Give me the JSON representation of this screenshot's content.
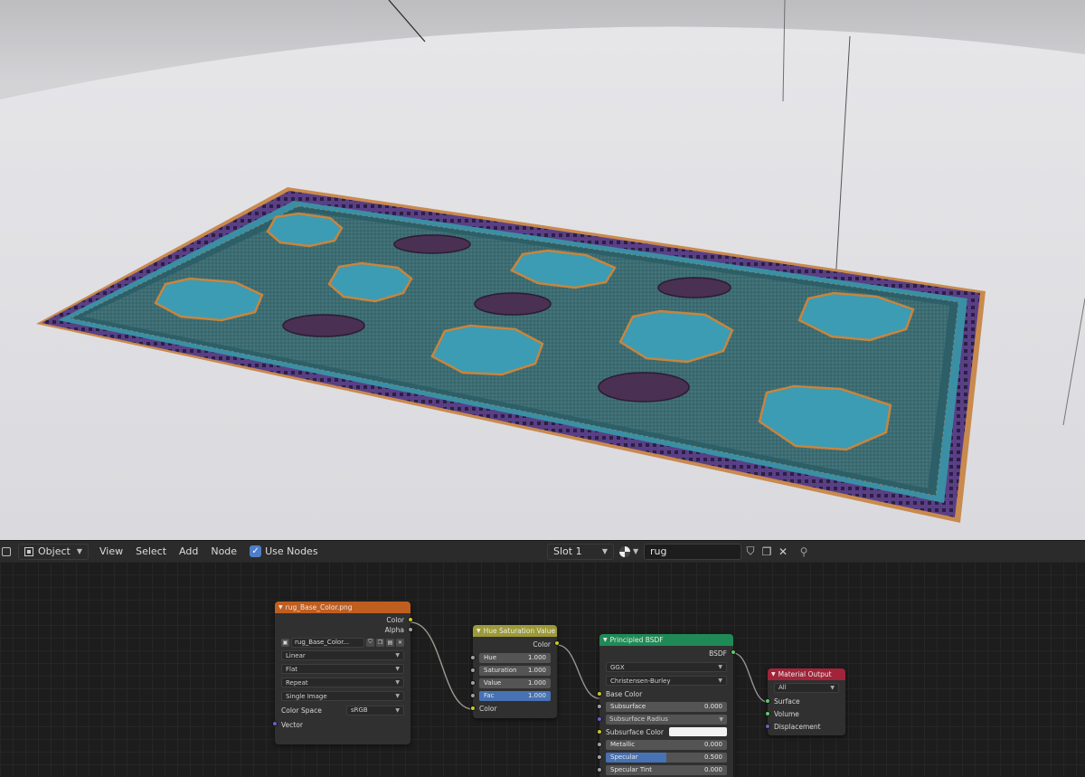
{
  "header": {
    "editor_type_icon": "node-editor-icon",
    "object_mode_label": "Object",
    "menu": [
      "View",
      "Select",
      "Add",
      "Node"
    ],
    "use_nodes_label": "Use Nodes",
    "use_nodes_checked": true,
    "slot_label": "Slot 1",
    "material_name": "rug"
  },
  "nodes": {
    "image_texture": {
      "title": "rug_Base_Color.png",
      "outputs": [
        "Color",
        "Alpha"
      ],
      "image_name": "rug_Base_Color...",
      "interpolation": "Linear",
      "projection": "Flat",
      "extension": "Repeat",
      "source": "Single Image",
      "color_space_label": "Color Space",
      "color_space": "sRGB",
      "input_vector": "Vector"
    },
    "hue_sat": {
      "title": "Hue Saturation Value",
      "output": "Color",
      "hue": {
        "label": "Hue",
        "value": "1.000"
      },
      "saturation": {
        "label": "Saturation",
        "value": "1.000"
      },
      "value": {
        "label": "Value",
        "value": "1.000"
      },
      "fac": {
        "label": "Fac",
        "value": "1.000"
      },
      "input_color": "Color"
    },
    "principled": {
      "title": "Principled BSDF",
      "output": "BSDF",
      "distribution": "GGX",
      "subsurface_method": "Christensen-Burley",
      "base_color": "Base Color",
      "subsurface": {
        "label": "Subsurface",
        "value": "0.000"
      },
      "subsurface_radius": "Subsurface Radius",
      "subsurface_color": "Subsurface Color",
      "metallic": {
        "label": "Metallic",
        "value": "0.000"
      },
      "specular": {
        "label": "Specular",
        "value": "0.500"
      },
      "specular_tint": {
        "label": "Specular Tint",
        "value": "0.000"
      }
    },
    "material_output": {
      "title": "Material Output",
      "target": "All",
      "inputs": [
        "Surface",
        "Volume",
        "Displacement"
      ]
    }
  },
  "colors": {
    "texture_header": "#c05e1f",
    "color_header": "#9c9a37",
    "shader_header": "#1f8a55",
    "output_header": "#a1243a",
    "accent": "#4772b3"
  }
}
